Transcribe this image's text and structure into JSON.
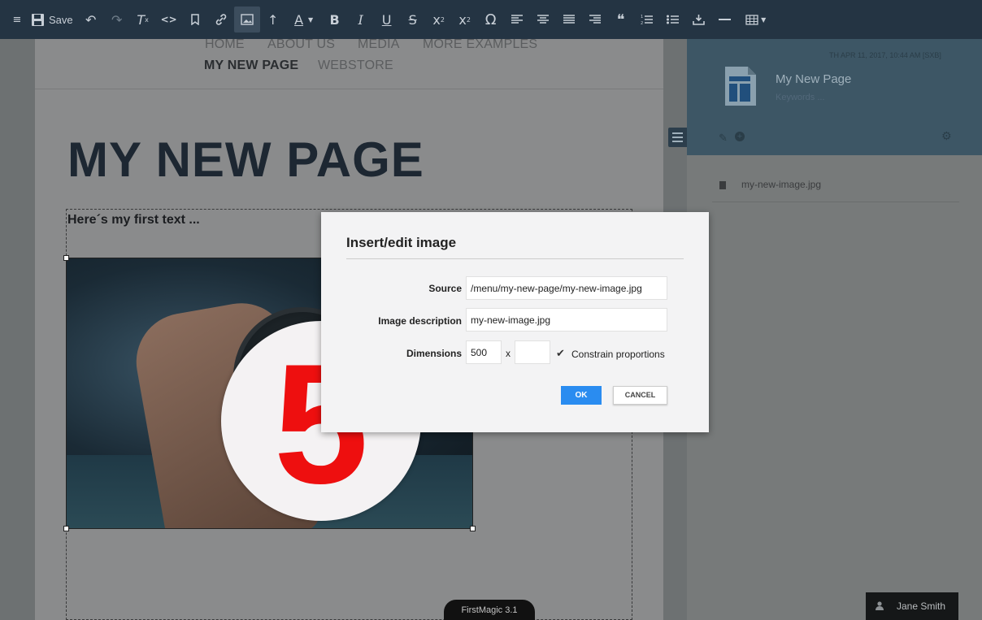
{
  "toolbar": {
    "save_label": "Save",
    "italic_glyph": "I",
    "bold_glyph": "B",
    "underline_glyph": "U",
    "strike_glyph": "S",
    "sup_base": "x",
    "sup_mark": "2",
    "sub_base": "x",
    "sub_mark": "2",
    "omega_glyph": "Ω",
    "quote_glyph": "❝",
    "font_color_glyph": "A",
    "clear_format_glyph": "T",
    "clear_format_mark": "x",
    "code_glyph": "<>"
  },
  "nav": {
    "items": [
      "HOME",
      "ABOUT US",
      "MEDIA",
      "MORE EXAMPLES",
      "MY NEW PAGE",
      "WEBSTORE"
    ]
  },
  "page": {
    "title": "MY NEW PAGE",
    "first_text": "Here´s my first text ...",
    "badge_number": "5"
  },
  "footer": {
    "version": "FirstMagic 3.1"
  },
  "sidebar": {
    "date": "TH APR 11, 2017, 10:44 AM [SXB]",
    "page_title": "My New Page",
    "keywords_placeholder": "Keywords ...",
    "file_name": "my-new-image.jpg",
    "user_name": "Jane Smith"
  },
  "dialog": {
    "title": "Insert/edit image",
    "source_label": "Source",
    "source_value": "/menu/my-new-page/my-new-image.jpg",
    "description_label": "Image description",
    "description_value": "my-new-image.jpg",
    "dimensions_label": "Dimensions",
    "width_value": "500",
    "height_value": "",
    "dimension_separator": "x",
    "constrain_label": "Constrain proportions",
    "ok_label": "OK",
    "cancel_label": "CANCEL"
  },
  "colors": {
    "toolbar_bg": "#243443",
    "sidebar_header_bg": "#3d5665",
    "ok_button": "#2a8cf0",
    "badge_number": "#ee0f0f"
  }
}
